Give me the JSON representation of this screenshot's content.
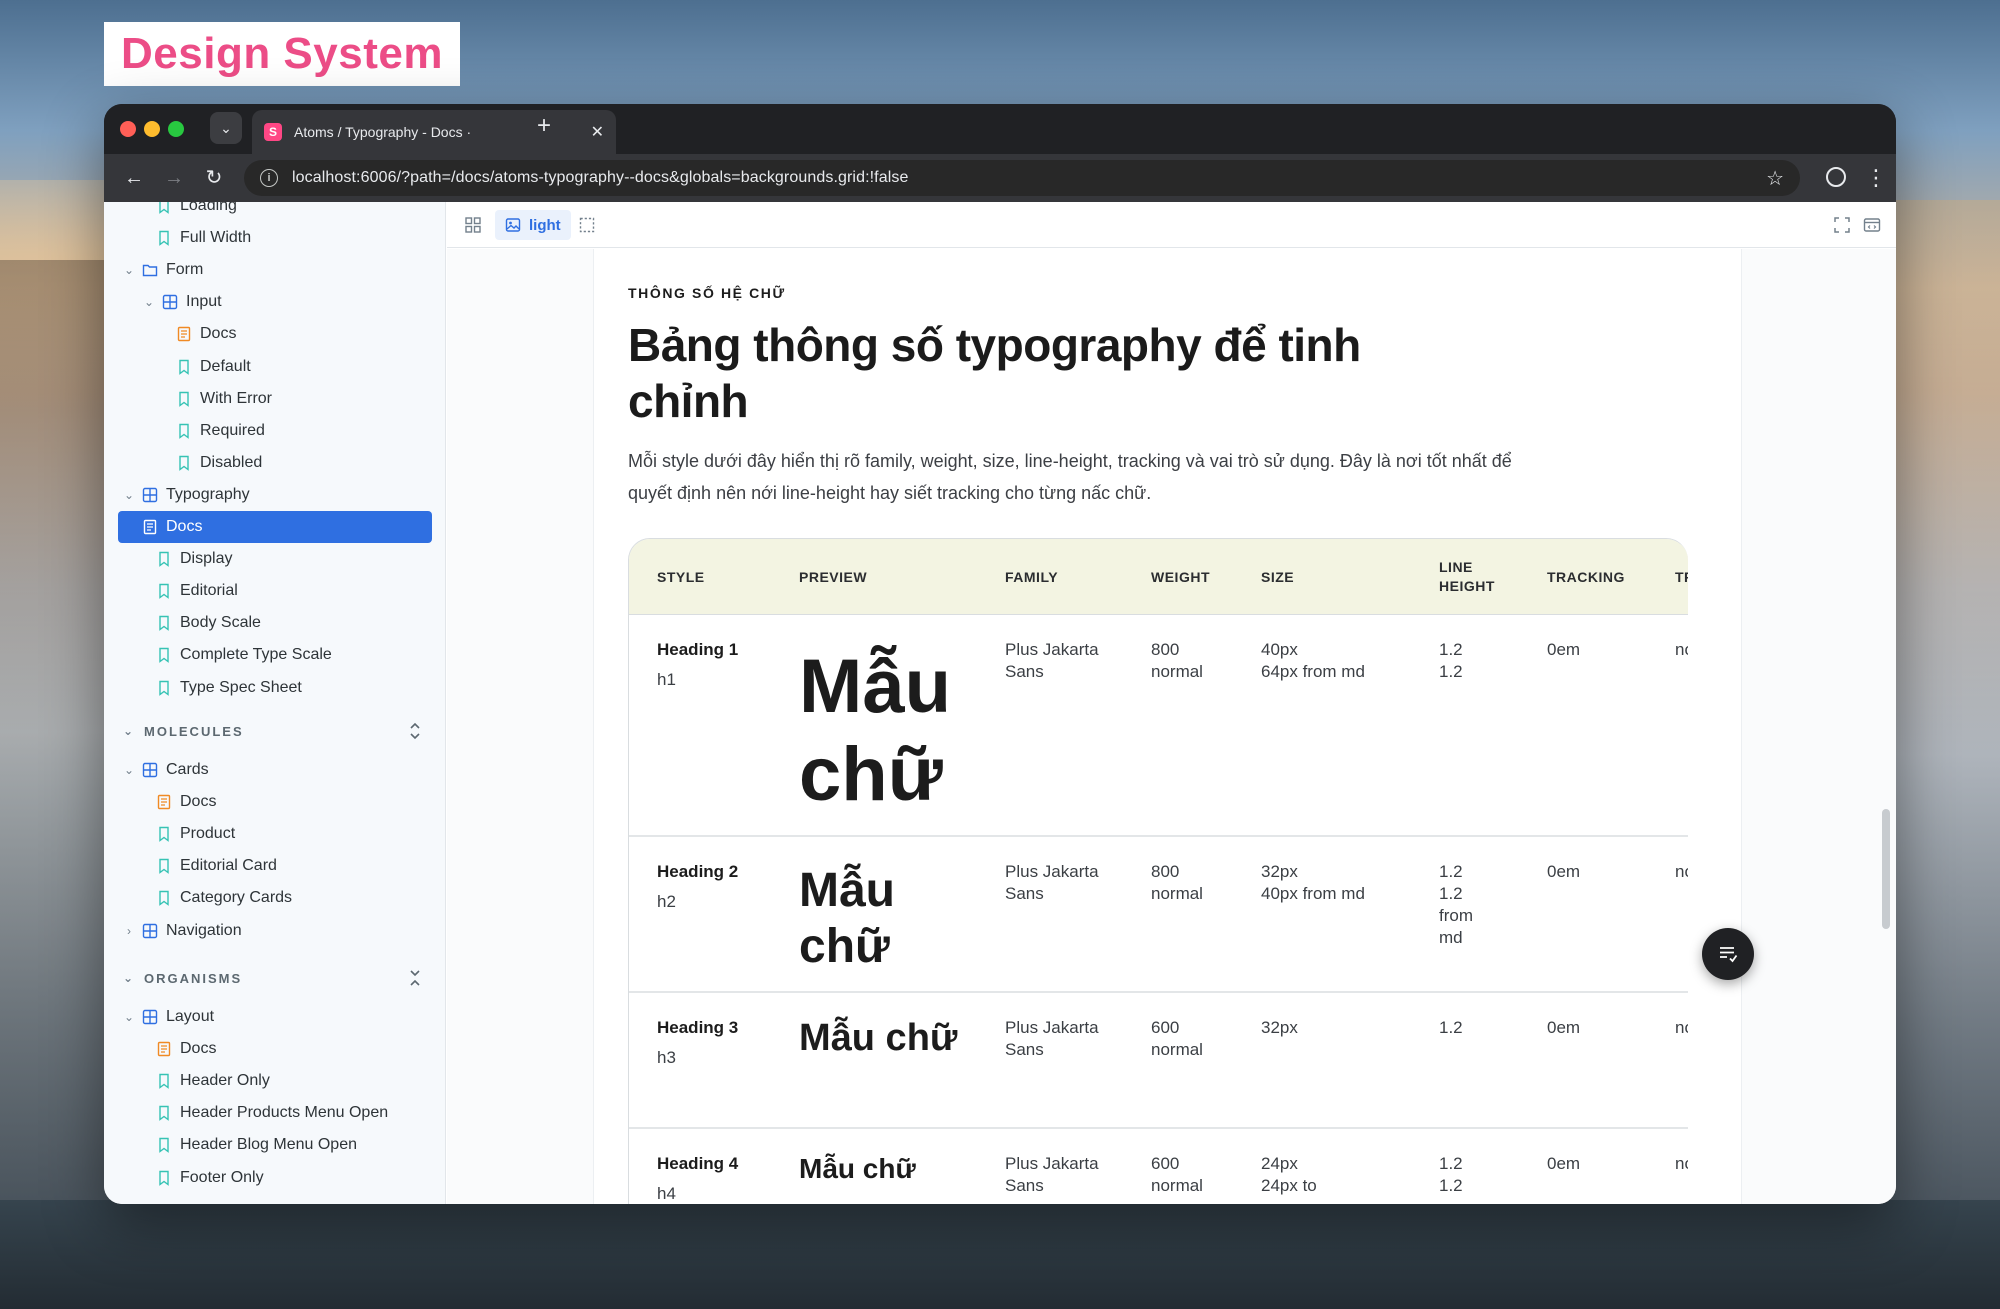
{
  "badge": {
    "label": "Design System"
  },
  "browser": {
    "tab_title": "Atoms / Typography - Docs ·",
    "favicon_letter": "S",
    "url": "localhost:6006/?path=/docs/atoms-typography--docs&globals=backgrounds.grid:!false",
    "icons": [
      "tab-search-icon",
      "close-icon",
      "new-tab-icon",
      "back-icon",
      "forward-icon",
      "reload-icon",
      "site-info-icon",
      "bookmark-star-icon",
      "profile-icon",
      "more-menu-icon"
    ]
  },
  "sidebar": {
    "rows_top": [
      {
        "label": "Loading",
        "kind": "story"
      },
      {
        "label": "Full Width",
        "kind": "story"
      },
      {
        "label": "Form",
        "kind": "folder"
      },
      {
        "label": "Input",
        "kind": "component"
      },
      {
        "label": "Docs",
        "kind": "docs"
      },
      {
        "label": "Default",
        "kind": "story"
      },
      {
        "label": "With Error",
        "kind": "story"
      },
      {
        "label": "Required",
        "kind": "story"
      },
      {
        "label": "Disabled",
        "kind": "story"
      },
      {
        "label": "Typography",
        "kind": "component"
      },
      {
        "label": "Docs",
        "kind": "docs-selected"
      },
      {
        "label": "Display",
        "kind": "story"
      },
      {
        "label": "Editorial",
        "kind": "story"
      },
      {
        "label": "Body Scale",
        "kind": "story"
      },
      {
        "label": "Complete Type Scale",
        "kind": "story"
      },
      {
        "label": "Type Spec Sheet",
        "kind": "story"
      }
    ],
    "molecules_title": "MOLECULES",
    "molecules": [
      {
        "label": "Cards",
        "kind": "component"
      },
      {
        "label": "Docs",
        "kind": "docs"
      },
      {
        "label": "Product",
        "kind": "story"
      },
      {
        "label": "Editorial Card",
        "kind": "story"
      },
      {
        "label": "Category Cards",
        "kind": "story"
      },
      {
        "label": "Navigation",
        "kind": "component-collapsed"
      }
    ],
    "organisms_title": "ORGANISMS",
    "organisms": [
      {
        "label": "Layout",
        "kind": "component"
      },
      {
        "label": "Docs",
        "kind": "docs"
      },
      {
        "label": "Header Only",
        "kind": "story"
      },
      {
        "label": "Header Products Menu Open",
        "kind": "story"
      },
      {
        "label": "Header Blog Menu Open",
        "kind": "story"
      },
      {
        "label": "Footer Only",
        "kind": "story"
      }
    ]
  },
  "toolbar": {
    "background_label": "light",
    "icons": [
      "grid-icon",
      "image-icon",
      "outline-icon",
      "fullscreen-icon",
      "open-new-tab-icon"
    ]
  },
  "doc": {
    "eyebrow": "THÔNG SỐ HỆ CHỮ",
    "title": "Bảng thông số typography để tinh chỉnh",
    "description": "Mỗi style dưới đây hiển thị rõ family, weight, size, line-height, tracking và vai trò sử dụng. Đây là nơi tốt nhất để quyết định nên nới line-height hay siết tracking cho từng nấc chữ.",
    "table": {
      "headers": {
        "style": "STYLE",
        "preview": "PREVIEW",
        "family": "FAMILY",
        "weight": "WEIGHT",
        "size": "SIZE",
        "line_height_1": "LINE",
        "line_height_2": "HEIGHT",
        "tracking": "TRACKING",
        "transform": "TRA"
      },
      "rows": [
        {
          "style": "Heading 1",
          "tag": "h1",
          "preview_1": "Mẫu",
          "preview_2": "chữ",
          "family_1": "Plus Jakarta",
          "family_2": "Sans",
          "weight_1": "800",
          "weight_2": "normal",
          "size_1": "40px",
          "size_2": "64px from md",
          "lh_1": "1.2",
          "lh_2": "1.2",
          "lh_3": "",
          "lh_4": "",
          "tracking": "0em",
          "transform": "nor"
        },
        {
          "style": "Heading 2",
          "tag": "h2",
          "preview_1": "Mẫu",
          "preview_2": "chữ",
          "family_1": "Plus Jakarta",
          "family_2": "Sans",
          "weight_1": "800",
          "weight_2": "normal",
          "size_1": "32px",
          "size_2": "40px from md",
          "lh_1": "1.2",
          "lh_2": "1.2",
          "lh_3": "from",
          "lh_4": "md",
          "tracking": "0em",
          "transform": "nor"
        },
        {
          "style": "Heading 3",
          "tag": "h3",
          "preview_1": "Mẫu chữ",
          "preview_2": "",
          "family_1": "Plus Jakarta",
          "family_2": "Sans",
          "weight_1": "600",
          "weight_2": "normal",
          "size_1": "32px",
          "size_2": "",
          "lh_1": "1.2",
          "lh_2": "",
          "lh_3": "",
          "lh_4": "",
          "tracking": "0em",
          "transform": "nor"
        },
        {
          "style": "Heading 4",
          "tag": "h4",
          "preview_1": "Mẫu chữ",
          "preview_2": "",
          "family_1": "Plus Jakarta",
          "family_2": "Sans",
          "weight_1": "600",
          "weight_2": "normal",
          "size_1": "24px",
          "size_2": "24px to",
          "lh_1": "1.2",
          "lh_2": "1.2",
          "lh_3": "",
          "lh_4": "",
          "tracking": "0em",
          "transform": "nor"
        }
      ]
    }
  },
  "fab": {
    "icon": "format-list-icon"
  },
  "colors": {
    "accent": "#2f6fe1",
    "badge_text": "#ec4d87",
    "table_header_bg": "#f3f4e2",
    "story_icon": "#36c3b4",
    "docs_icon": "#f08a24",
    "component_icon": "#2f6fe1",
    "folder_icon": "#2f6fe1"
  }
}
